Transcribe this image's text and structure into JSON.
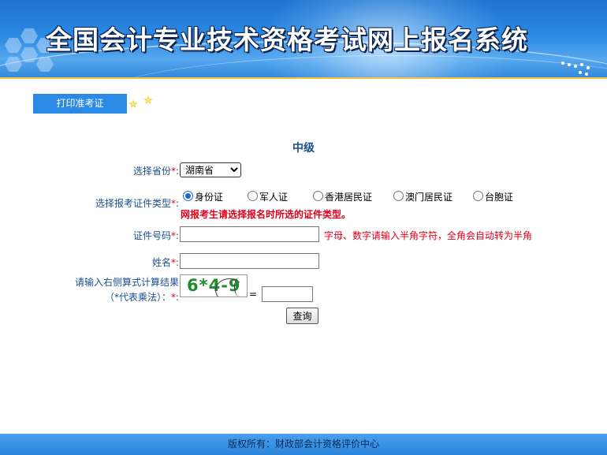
{
  "header": {
    "title": "全国会计专业技术资格考试网上报名系统"
  },
  "nav": {
    "tab_label": "打印准考证"
  },
  "form": {
    "level": "中级",
    "province": {
      "label": "选择省份",
      "required_mark": "*",
      "colon": ":",
      "selected": "湖南省"
    },
    "id_type": {
      "label": "选择报考证件类型",
      "required_mark": "*",
      "colon": ":",
      "options": [
        {
          "label": "身份证",
          "checked": true
        },
        {
          "label": "军人证",
          "checked": false
        },
        {
          "label": "香港居民证",
          "checked": false
        },
        {
          "label": "澳门居民证",
          "checked": false
        },
        {
          "label": "台胞证",
          "checked": false
        }
      ],
      "warning": "网报考生请选择报名时所选的证件类型。"
    },
    "id_number": {
      "label": "证件号码",
      "required_mark": "*",
      "colon": ":",
      "value": "",
      "hint": "字母、数字请输入半角字符，全角会自动转为半角"
    },
    "name": {
      "label": "姓名",
      "required_mark": "*",
      "colon": ":",
      "value": ""
    },
    "captcha": {
      "label_line1": "请输入右侧算式计算结果",
      "label_line2": "（*代表乘法）：",
      "required_mark": "*",
      "colon": ":",
      "expression": "6*4-9",
      "equals": "=",
      "value": ""
    },
    "submit_label": "查询"
  },
  "footer": {
    "copyright": "版权所有：财政部会计资格评价中心"
  },
  "colors": {
    "banner_blue": "#2b88e2",
    "accent_orange": "#e59a1c",
    "label_blue": "#1a4f8f",
    "required_red": "#e0001b",
    "captcha_green": "#1f8c2c"
  }
}
